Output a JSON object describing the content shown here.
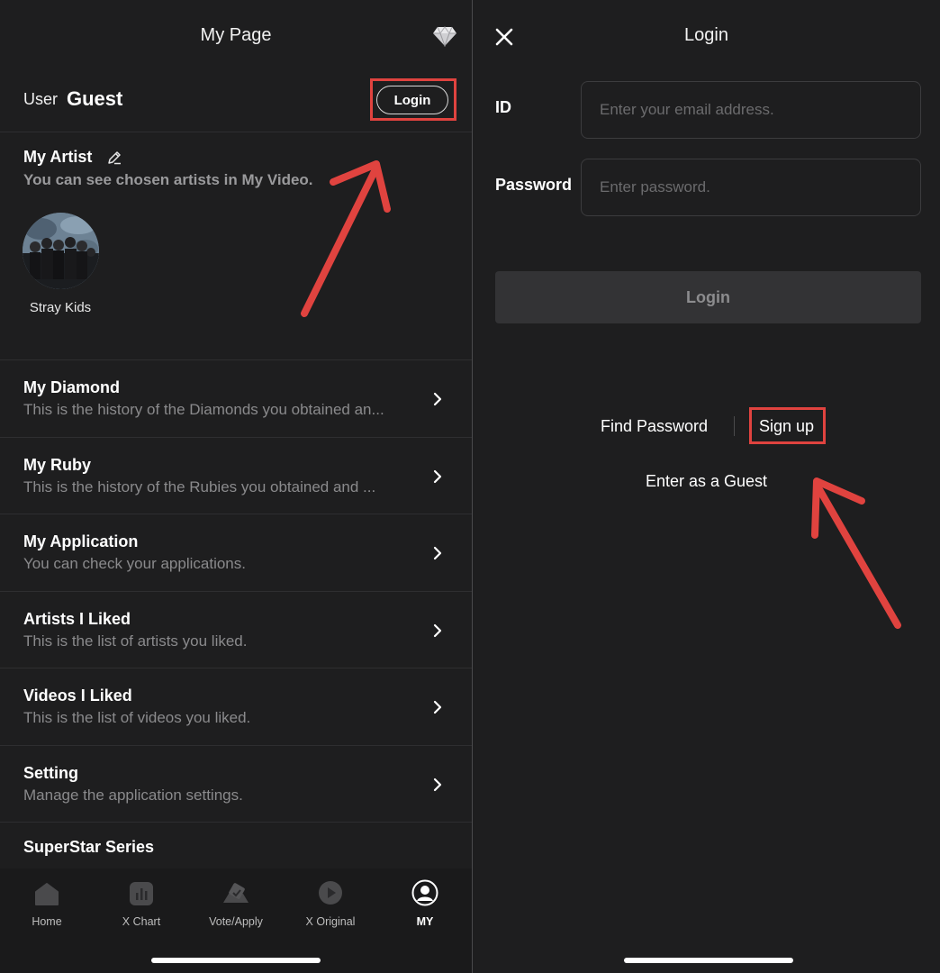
{
  "left": {
    "title": "My Page",
    "user_label": "User",
    "user_name": "Guest",
    "login_label": "Login",
    "my_artist": {
      "title": "My Artist",
      "description": "You can see chosen artists in My Video.",
      "artists": [
        {
          "name": "Stray Kids"
        }
      ]
    },
    "menu": [
      {
        "title": "My Diamond",
        "desc": "This is the history of the Diamonds you obtained an..."
      },
      {
        "title": "My Ruby",
        "desc": "This is the history of the Rubies you obtained and ..."
      },
      {
        "title": "My Application",
        "desc": "You can check your applications."
      },
      {
        "title": "Artists I Liked",
        "desc": "This is the list of artists you liked."
      },
      {
        "title": "Videos I Liked",
        "desc": "This is the list of videos you liked."
      },
      {
        "title": "Setting",
        "desc": "Manage the application settings."
      }
    ],
    "superstar_title": "SuperStar Series",
    "tabs": [
      {
        "label": "Home",
        "icon": "home-icon"
      },
      {
        "label": "X Chart",
        "icon": "chart-icon"
      },
      {
        "label": "Vote/Apply",
        "icon": "vote-icon"
      },
      {
        "label": "X Original",
        "icon": "play-icon"
      },
      {
        "label": "MY",
        "icon": "profile-icon",
        "active": true
      }
    ]
  },
  "right": {
    "title": "Login",
    "id_label": "ID",
    "id_placeholder": "Enter your email address.",
    "password_label": "Password",
    "password_placeholder": "Enter password.",
    "login_button": "Login",
    "find_password": "Find Password",
    "sign_up": "Sign up",
    "guest": "Enter as a Guest"
  },
  "colors": {
    "background": "#1e1e1f",
    "highlight": "#e0433f",
    "muted_text": "#8a8a8c"
  }
}
